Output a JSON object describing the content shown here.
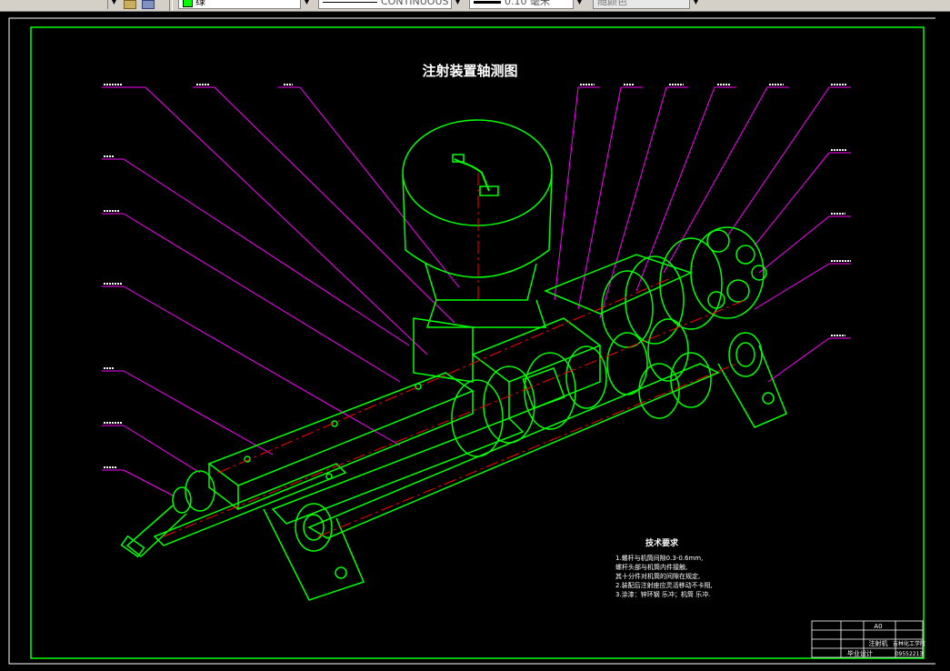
{
  "toolbar": {
    "color_label": "绿",
    "linetype_label": "CONTINUOUS",
    "lineweight_label": "0.10 毫米",
    "plotstyle_label": "随颜色"
  },
  "drawing": {
    "title": "注射装置轴测图",
    "tech_title": "技术要求",
    "tech_lines": [
      "1.螺杆与机筒间隙0.3-0.6mm,",
      "  螺杆头部与机筒内件接触,",
      "  其十分件对机筒的间隙在规定,",
      "2.装配后注射座应灵活移动不卡阻,",
      "3.涂漆：锌环钢 乐冲；机筒 乐冲."
    ],
    "title_block": {
      "name": "注射机",
      "subtitle": "毕业设计",
      "code": "A0",
      "school": "吉林化工学院",
      "id": "09552213"
    }
  },
  "colors": {
    "green": "#00ff00",
    "magenta": "#ff00ff",
    "red": "#ff0000",
    "white": "#ffffff"
  }
}
